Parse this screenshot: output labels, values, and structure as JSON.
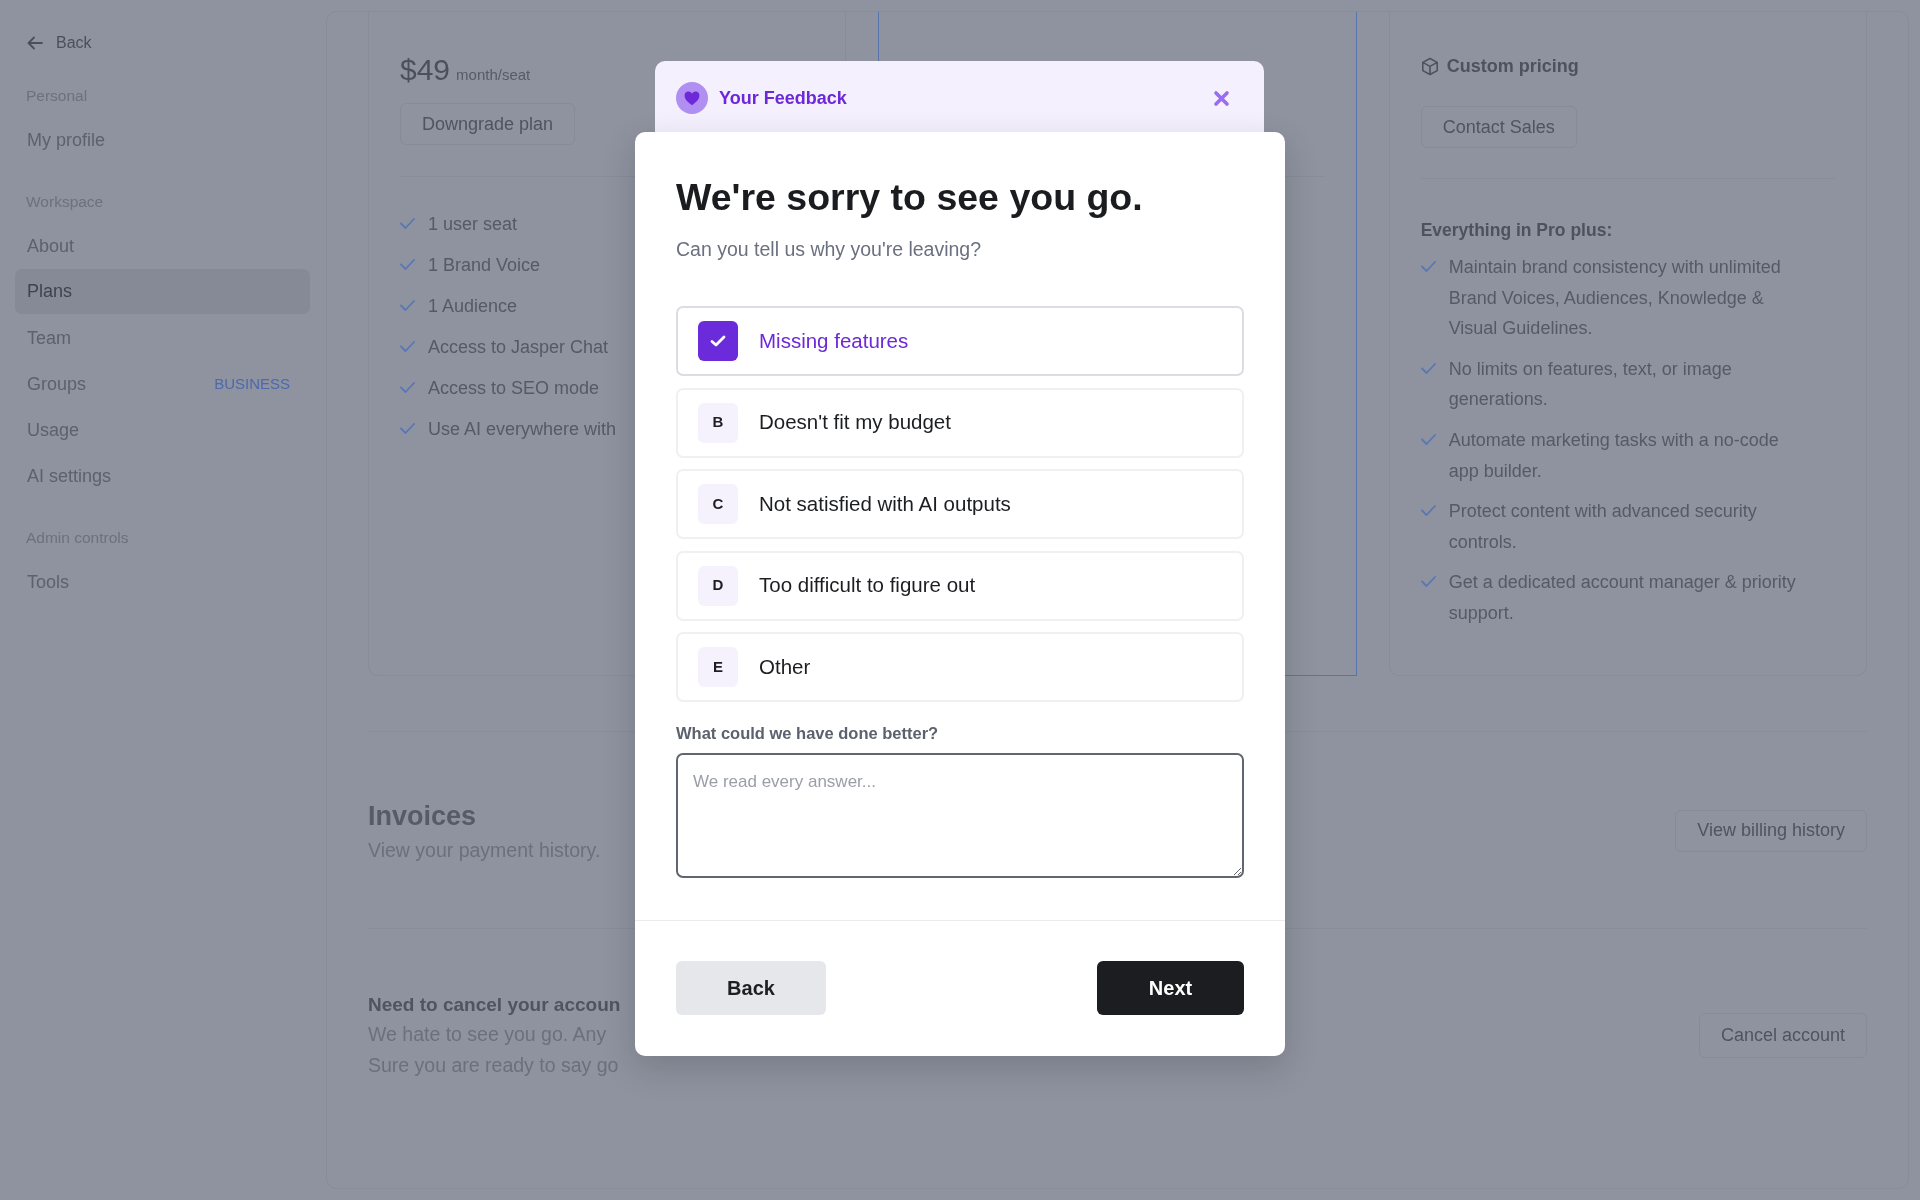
{
  "sidebar": {
    "back": "Back",
    "sections": [
      {
        "heading": "Personal",
        "items": [
          {
            "label": "My profile",
            "selected": false
          }
        ]
      },
      {
        "heading": "Workspace",
        "items": [
          {
            "label": "About",
            "selected": false
          },
          {
            "label": "Plans",
            "selected": true
          },
          {
            "label": "Team",
            "selected": false
          },
          {
            "label": "Groups",
            "selected": false,
            "tag": "BUSINESS"
          },
          {
            "label": "Usage",
            "selected": false
          },
          {
            "label": "AI settings",
            "selected": false
          }
        ]
      },
      {
        "heading": "Admin controls",
        "items": [
          {
            "label": "Tools",
            "selected": false
          }
        ]
      }
    ]
  },
  "plans": [
    {
      "highlighted": false,
      "price": "$49",
      "period": "month/seat",
      "button": "Downgrade plan",
      "features": [
        "1 user seat",
        "1 Brand Voice",
        "1 Audience",
        "Access to Jasper Chat",
        "Access to SEO mode",
        "Use AI everywhere with"
      ]
    },
    {
      "highlighted": true
    },
    {
      "highlighted": false,
      "pricing_label": "Custom pricing",
      "button": "Contact Sales",
      "features_heading": "Everything in Pro plus:",
      "features": [
        "Maintain brand consistency with unlimited Brand Voices, Audiences, Knowledge & Visual Guidelines.",
        "No limits on features, text, or image generations.",
        "Automate marketing tasks with a no-code app builder.",
        "Protect content with advanced security controls.",
        "Get a dedicated account manager & priority support."
      ]
    }
  ],
  "invoices": {
    "title": "Invoices",
    "description": "View your payment history.",
    "button": "View billing history"
  },
  "cancel": {
    "title": "Need to cancel your accoun",
    "lines": [
      "We hate to see you go. Any",
      "Sure you are ready to say go"
    ],
    "button": "Cancel account"
  },
  "modal": {
    "header": "Your Feedback",
    "title": "We're sorry to see you go.",
    "subtitle": "Can you tell us why you're leaving?",
    "options": [
      {
        "label": "Missing features",
        "checked": true
      },
      {
        "key": "B",
        "label": "Doesn't fit my budget",
        "checked": false
      },
      {
        "key": "C",
        "label": "Not satisfied with AI outputs",
        "checked": false
      },
      {
        "key": "D",
        "label": "Too difficult to figure out",
        "checked": false
      },
      {
        "key": "E",
        "label": "Other",
        "checked": false
      }
    ],
    "feedback": {
      "label": "What could we have done better?",
      "placeholder": "We read every answer..."
    },
    "buttons": [
      {
        "label": "Back",
        "kind": "secondary"
      },
      {
        "label": "Next",
        "kind": "primary"
      }
    ]
  }
}
